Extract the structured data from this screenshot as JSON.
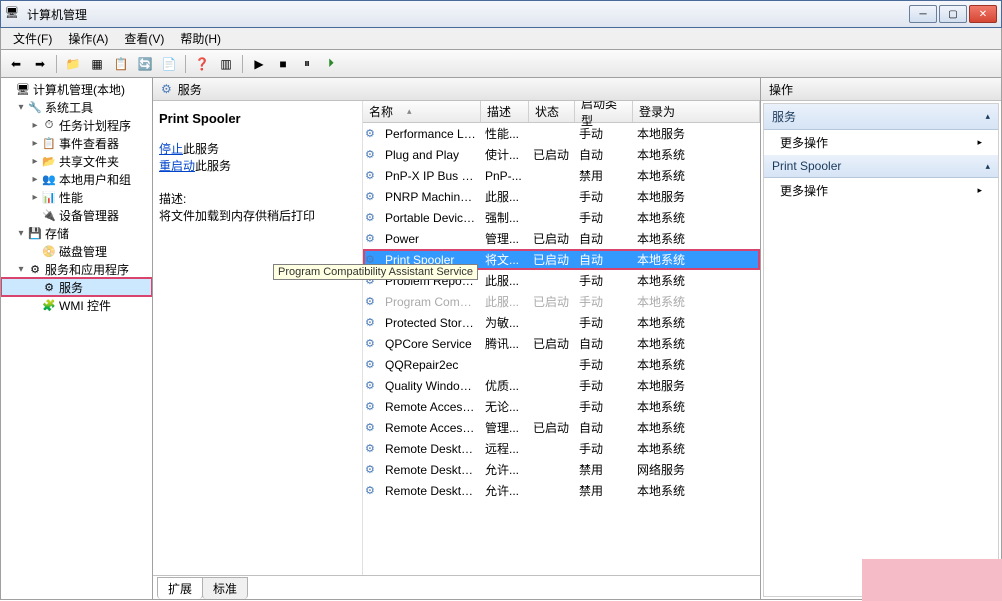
{
  "titlebar": {
    "title": "计算机管理"
  },
  "menubar": {
    "file": "文件(F)",
    "action": "操作(A)",
    "view": "查看(V)",
    "help": "帮助(H)"
  },
  "tree": {
    "root": "计算机管理(本地)",
    "n1": "系统工具",
    "n1a": "任务计划程序",
    "n1b": "事件查看器",
    "n1c": "共享文件夹",
    "n1d": "本地用户和组",
    "n1e": "性能",
    "n1f": "设备管理器",
    "n2": "存储",
    "n2a": "磁盘管理",
    "n3": "服务和应用程序",
    "n3a": "服务",
    "n3b": "WMI 控件"
  },
  "mid": {
    "heading": "服务",
    "detail_name": "Print Spooler",
    "link_stop": "停止",
    "stop_suffix": "此服务",
    "link_restart": "重启动",
    "restart_suffix": "此服务",
    "desc_label": "描述:",
    "desc_text": "将文件加载到内存供稍后打印"
  },
  "cols": {
    "name": "名称",
    "desc": "描述",
    "stat": "状态",
    "start": "启动类型",
    "logon": "登录为"
  },
  "rows": [
    {
      "name": "Performance Lo...",
      "desc": "性能...",
      "stat": "",
      "start": "手动",
      "logon": "本地服务"
    },
    {
      "name": "Plug and Play",
      "desc": "使计...",
      "stat": "已启动",
      "start": "自动",
      "logon": "本地系统"
    },
    {
      "name": "PnP-X IP Bus En...",
      "desc": "PnP-...",
      "stat": "",
      "start": "禁用",
      "logon": "本地系统"
    },
    {
      "name": "PNRP Machine ...",
      "desc": "此服...",
      "stat": "",
      "start": "手动",
      "logon": "本地服务"
    },
    {
      "name": "Portable Device ...",
      "desc": "强制...",
      "stat": "",
      "start": "手动",
      "logon": "本地系统"
    },
    {
      "name": "Power",
      "desc": "管理...",
      "stat": "已启动",
      "start": "自动",
      "logon": "本地系统"
    },
    {
      "name": "Print Spooler",
      "desc": "将文...",
      "stat": "已启动",
      "start": "自动",
      "logon": "本地系统",
      "selected": true,
      "boxed": true
    },
    {
      "name": "Problem Report...",
      "desc": "此服...",
      "stat": "",
      "start": "手动",
      "logon": "本地系统"
    },
    {
      "name": "Program Compati...",
      "desc": "此服...",
      "stat": "已启动",
      "start": "手动",
      "logon": "本地系统",
      "faded": true
    },
    {
      "name": "Protected Storage",
      "desc": "为敏...",
      "stat": "",
      "start": "手动",
      "logon": "本地系统"
    },
    {
      "name": "QPCore Service",
      "desc": "腾讯...",
      "stat": "已启动",
      "start": "自动",
      "logon": "本地系统"
    },
    {
      "name": "QQRepair2ec",
      "desc": "",
      "stat": "",
      "start": "手动",
      "logon": "本地系统"
    },
    {
      "name": "Quality Windows...",
      "desc": "优质...",
      "stat": "",
      "start": "手动",
      "logon": "本地服务"
    },
    {
      "name": "Remote Access ...",
      "desc": "无论...",
      "stat": "",
      "start": "手动",
      "logon": "本地系统"
    },
    {
      "name": "Remote Access ...",
      "desc": "管理...",
      "stat": "已启动",
      "start": "自动",
      "logon": "本地系统"
    },
    {
      "name": "Remote Deskto...",
      "desc": "远程...",
      "stat": "",
      "start": "手动",
      "logon": "本地系统"
    },
    {
      "name": "Remote Deskto...",
      "desc": "允许...",
      "stat": "",
      "start": "禁用",
      "logon": "网络服务"
    },
    {
      "name": "Remote Deskto...",
      "desc": "允许...",
      "stat": "",
      "start": "禁用",
      "logon": "本地系统"
    }
  ],
  "tooltip": "Program Compatibility Assistant Service",
  "tabs": {
    "ext": "扩展",
    "std": "标准"
  },
  "actions": {
    "title": "操作",
    "sec1": "服务",
    "item1": "更多操作",
    "sec2": "Print Spooler",
    "item2": "更多操作"
  }
}
